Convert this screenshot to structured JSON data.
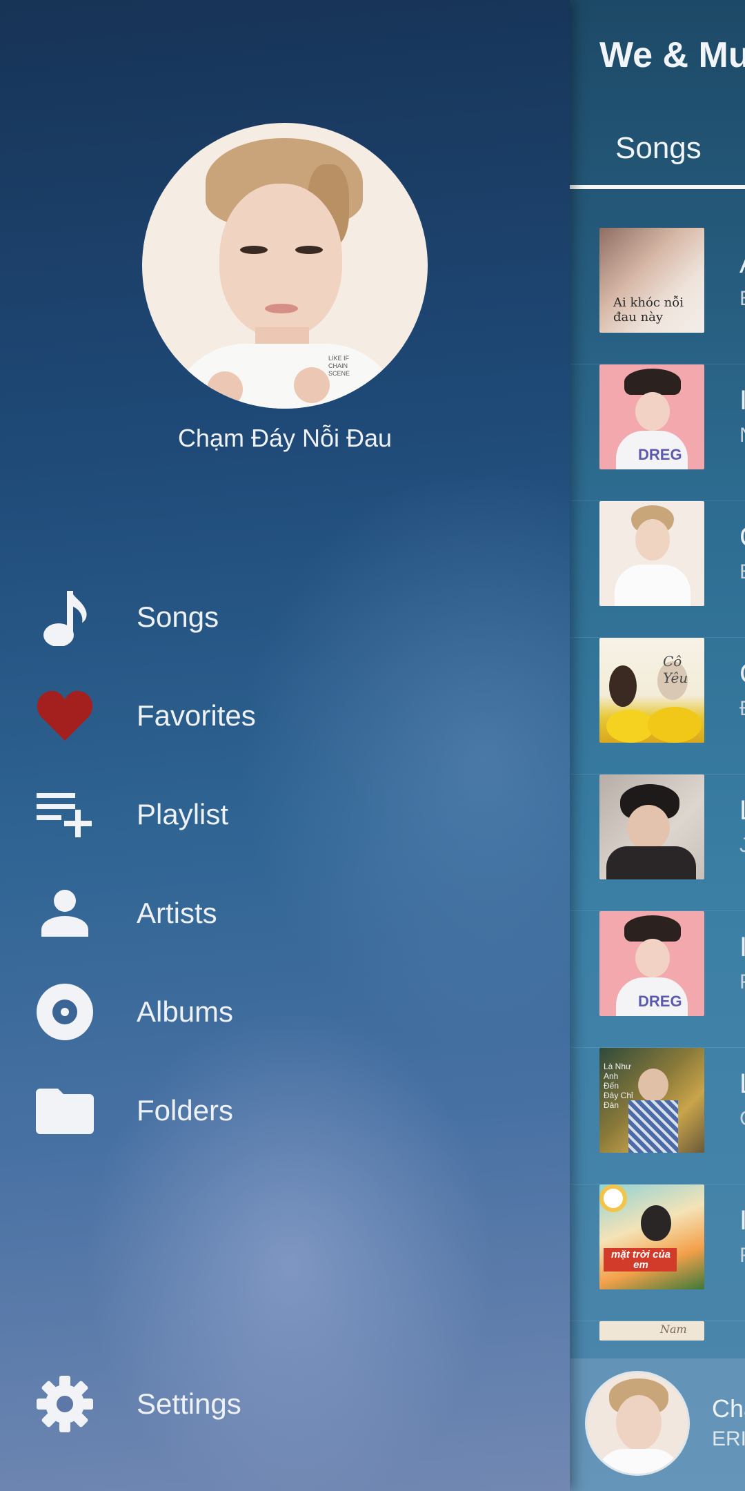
{
  "main": {
    "title": "We & Mu",
    "tab_songs": "Songs",
    "rows": [
      {
        "letter": "A",
        "sub": "E",
        "thumb_caption": "Ai khóc nỗi đau này"
      },
      {
        "letter": "I",
        "sub": "N"
      },
      {
        "letter": "C",
        "sub": "E"
      },
      {
        "letter": "C",
        "sub": "Đ",
        "thumb_caption": "Cô Yêu"
      },
      {
        "letter": "L",
        "sub": "J"
      },
      {
        "letter": "I",
        "sub": "F"
      },
      {
        "letter": "L",
        "sub": "C",
        "thumb_caption": "Là Như Anh Đến Đây Chỉ Đàn"
      },
      {
        "letter": "I",
        "sub": "F",
        "thumb_caption": "mặt trời của em"
      }
    ],
    "partial_row_caption": "Nam",
    "mini_player": {
      "title": "Cha",
      "artist": "ERI"
    }
  },
  "drawer": {
    "profile_name": "Chạm Đáy Nỗi Đau",
    "items": [
      {
        "label": "Songs",
        "icon": "music-note-icon"
      },
      {
        "label": "Favorites",
        "icon": "heart-icon"
      },
      {
        "label": "Playlist",
        "icon": "playlist-add-icon"
      },
      {
        "label": "Artists",
        "icon": "person-icon"
      },
      {
        "label": "Albums",
        "icon": "album-icon"
      },
      {
        "label": "Folders",
        "icon": "folder-icon"
      }
    ],
    "settings_label": "Settings"
  },
  "colors": {
    "heart": "#a3201f",
    "icon": "#f1f3f6",
    "text": "#eef2f6"
  }
}
